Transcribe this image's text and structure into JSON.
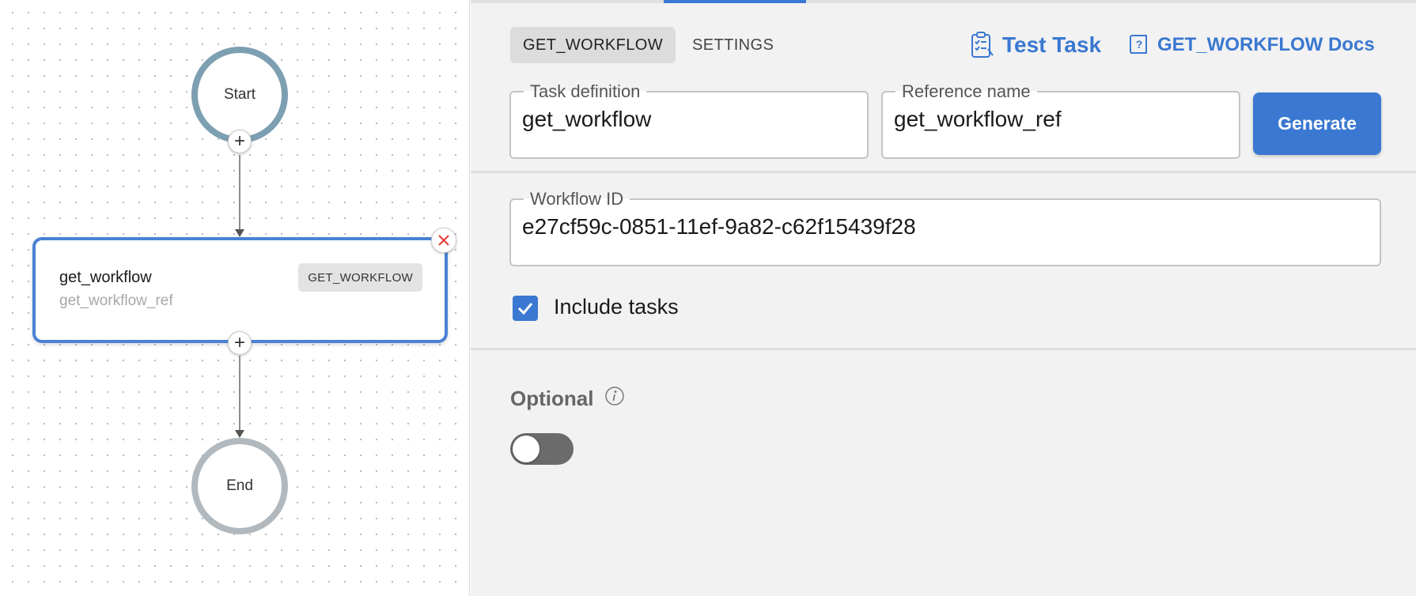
{
  "canvas": {
    "start_node": {
      "label": "Start"
    },
    "task_node": {
      "name": "get_workflow",
      "reference": "get_workflow_ref",
      "type_badge": "GET_WORKFLOW"
    },
    "end_node": {
      "label": "End"
    },
    "add_button_symbol": "+"
  },
  "panel": {
    "tabs": [
      {
        "label": "GET_WORKFLOW",
        "active": true
      },
      {
        "label": "SETTINGS",
        "active": false
      }
    ],
    "links": {
      "test_task": {
        "label": "Test Task",
        "icon": "checklist-icon"
      },
      "docs": {
        "label": "GET_WORKFLOW Docs",
        "icon": "help-book-icon"
      }
    },
    "fields": {
      "task_definition": {
        "label": "Task definition",
        "value": "get_workflow"
      },
      "reference_name": {
        "label": "Reference name",
        "value": "get_workflow_ref"
      },
      "workflow_id": {
        "label": "Workflow ID",
        "value": "e27cf59c-0851-11ef-9a82-c62f15439f28"
      }
    },
    "generate_button": {
      "label": "Generate"
    },
    "include_tasks": {
      "label": "Include tasks",
      "checked": true
    },
    "optional": {
      "label": "Optional",
      "enabled": false
    }
  },
  "colors": {
    "accent": "#3a78d1",
    "start_ring": "#7d9fb2",
    "end_ring": "#b1b9be",
    "remove_red": "#e53935",
    "panel_bg": "#f2f2f2"
  }
}
